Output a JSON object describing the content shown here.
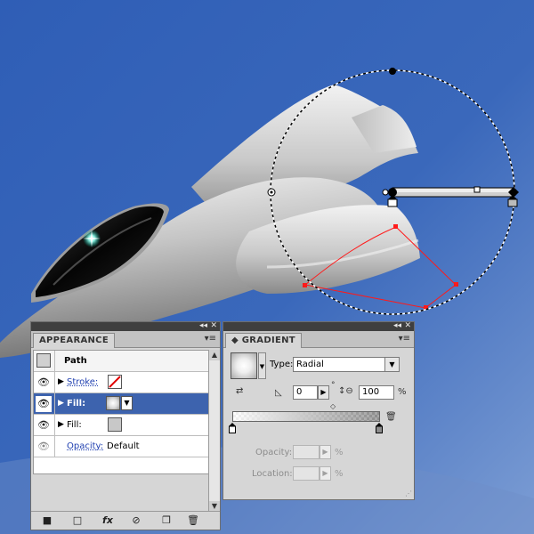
{
  "appearance": {
    "tab": "APPEARANCE",
    "panel_controls": [
      "◂◂",
      "✕"
    ],
    "menu_icon": "panel-menu-icon",
    "header": {
      "label": "Path"
    },
    "rows": [
      {
        "label": "Stroke:",
        "kind": "stroke",
        "swatch": "none"
      },
      {
        "label": "Fill:",
        "kind": "fill",
        "swatch": "radial-gradient",
        "selected": true
      },
      {
        "label": "Fill:",
        "kind": "fill",
        "swatch": "#c8c8c8"
      },
      {
        "label": "Opacity:",
        "kind": "opacity",
        "value": "Default"
      }
    ],
    "footer_icons": [
      "new-stroke-icon",
      "new-fill-icon",
      "fx-icon",
      "clear-icon",
      "duplicate-icon",
      "trash-icon"
    ],
    "footer_fx_label": "fx"
  },
  "gradient": {
    "tab": "GRADIENT",
    "panel_controls": [
      "◂◂",
      "✕"
    ],
    "type_label": "Type:",
    "type_value": "Radial",
    "angle_value": "0",
    "degree_symbol": "°",
    "aspect_value": "100",
    "aspect_unit": "%",
    "opacity_label": "Opacity:",
    "location_label": "Location:",
    "percent": "%"
  },
  "colors": {
    "sky_top": "#3561b4",
    "sky_bottom": "#7a9bd3",
    "selection_blue": "#3d63ae",
    "path_red": "#ff1a1a",
    "link_blue": "#1f3fb0"
  }
}
